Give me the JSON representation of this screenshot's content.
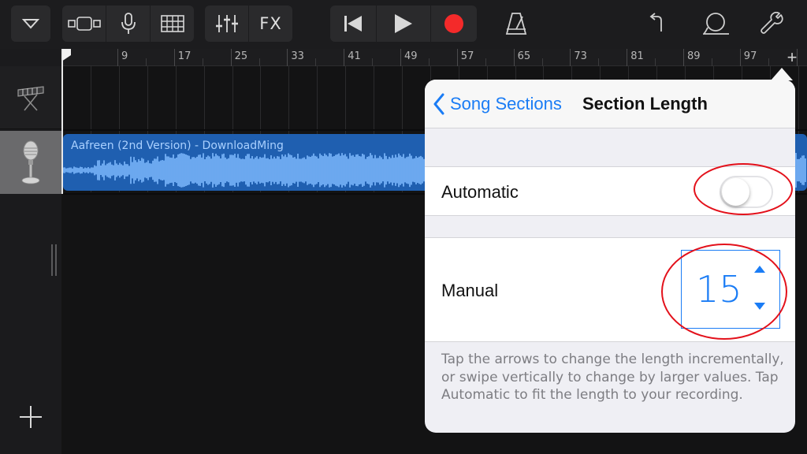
{
  "toolbar": {
    "browser_icon": "triangle-down-icon",
    "view_icon": "track-view-icon",
    "mic_icon": "microphone-icon",
    "grid_icon": "grid-icon",
    "mixer_icon": "mixer-sliders-icon",
    "fx_label": "FX",
    "rewind_icon": "go-to-start-icon",
    "play_icon": "play-icon",
    "record_icon": "record-icon",
    "metronome_icon": "metronome-icon",
    "undo_icon": "undo-icon",
    "loop_icon": "loop-icon",
    "settings_icon": "wrench-icon"
  },
  "ruler": {
    "bars": [
      "9",
      "17",
      "25",
      "33",
      "41",
      "49",
      "57",
      "65",
      "73",
      "81",
      "89",
      "97"
    ]
  },
  "tracks": [
    {
      "instrument_icon": "keyboard-icon"
    },
    {
      "instrument_icon": "microphone-icon",
      "selected": true
    }
  ],
  "region": {
    "title": "Aafreen (2nd Version) -  DownloadMing",
    "color": "#1f5fb0"
  },
  "popover": {
    "back_label": "Song Sections",
    "title": "Section Length",
    "automatic_label": "Automatic",
    "automatic_on": false,
    "manual_label": "Manual",
    "manual_value": "15",
    "hint": "Tap the arrows to change the length incrementally, or swipe vertically to change by larger values. Tap Automatic to fit the length to your recording."
  },
  "colors": {
    "accent": "#1a7cf5",
    "record": "#f42a2a",
    "annotation": "#e3111b"
  }
}
